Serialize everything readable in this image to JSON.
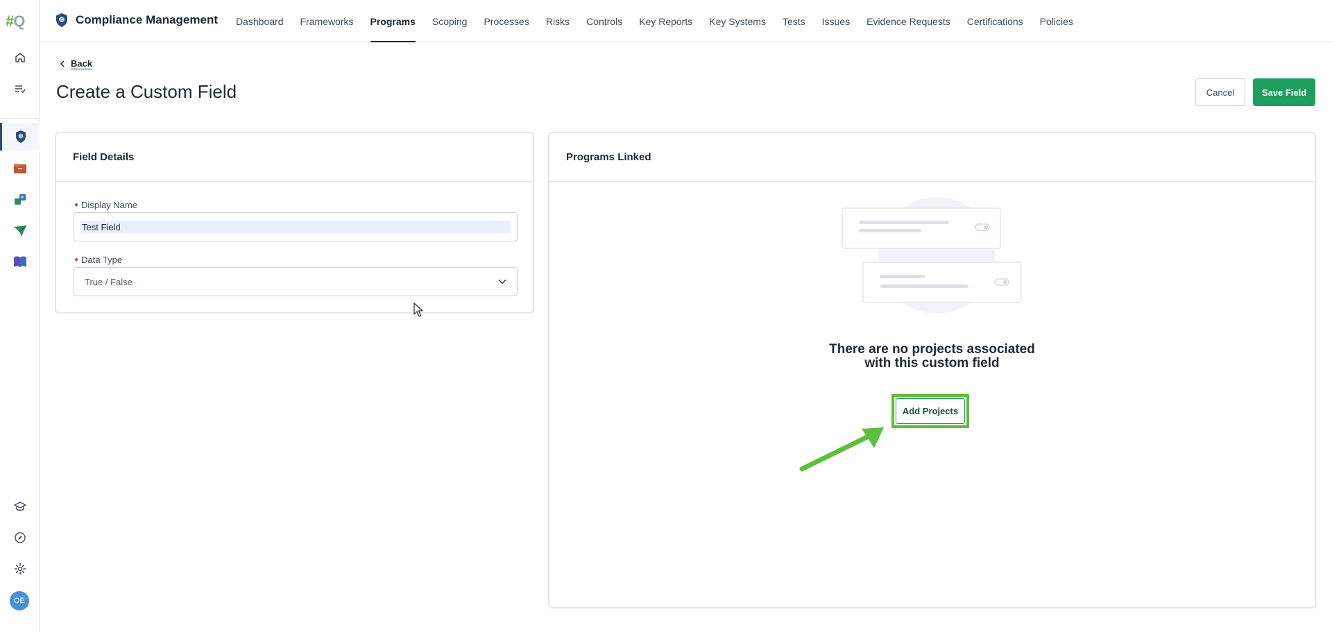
{
  "app": {
    "logo_hash": "#",
    "logo_q": "Q",
    "title": "Compliance Management"
  },
  "rail": {
    "items": [
      {
        "icon": "home-icon"
      },
      {
        "icon": "task-list-icon"
      },
      {
        "icon": "compliance-badge-icon",
        "active": true
      },
      {
        "icon": "folder-icon"
      },
      {
        "icon": "integrations-icon"
      },
      {
        "icon": "paper-plane-icon"
      },
      {
        "icon": "book-icon"
      },
      {
        "icon": "graduation-cap-icon"
      },
      {
        "icon": "compass-icon"
      },
      {
        "icon": "gear-icon"
      }
    ],
    "avatar_initials": "OE"
  },
  "nav": {
    "items": [
      "Dashboard",
      "Frameworks",
      "Programs",
      "Scoping",
      "Processes",
      "Risks",
      "Controls",
      "Key Reports",
      "Key Systems",
      "Tests",
      "Issues",
      "Evidence Requests",
      "Certifications",
      "Policies"
    ],
    "active": "Programs"
  },
  "page": {
    "back_label": "Back",
    "title": "Create a Custom Field",
    "cancel_label": "Cancel",
    "save_label": "Save Field"
  },
  "details": {
    "heading": "Field Details",
    "display_name_label": "Display Name",
    "display_name_value": "Test Field",
    "data_type_label": "Data Type",
    "data_type_value": "True / False"
  },
  "linked": {
    "heading": "Programs Linked",
    "empty_line1": "There are no projects associated",
    "empty_line2": "with this custom field",
    "add_label": "Add Projects"
  },
  "colors": {
    "accent": "#1e9e5f",
    "highlight": "#5cc03a",
    "nav_active": "#1f2933"
  }
}
